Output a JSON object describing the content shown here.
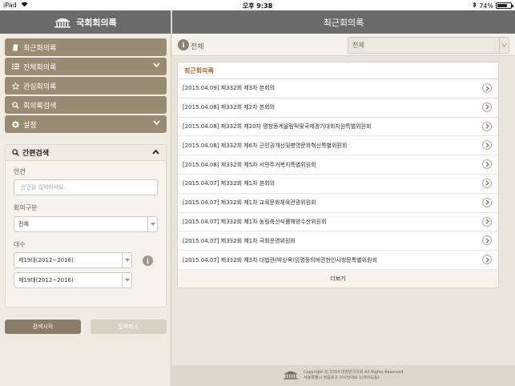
{
  "status_bar": {
    "device": "iPad",
    "time": "오후 9:38",
    "battery": "74%",
    "battery_level": 0.74
  },
  "sidebar": {
    "app_title": "국회회의록",
    "menu": [
      {
        "label": "최근회의록",
        "icon": "document-icon",
        "expand": false
      },
      {
        "label": "전체회의록",
        "icon": "list-icon",
        "expand": true
      },
      {
        "label": "관심회의록",
        "icon": "star-icon",
        "expand": false
      },
      {
        "label": "회의록검색",
        "icon": "search-icon",
        "expand": false
      },
      {
        "label": "설정",
        "icon": "gear-icon",
        "expand": true
      }
    ],
    "quick_search": {
      "title": "간편검색",
      "agenda_label": "안건",
      "agenda_placeholder": "안건을 입력하세요.",
      "meeting_type_label": "회의구분",
      "meeting_type_value": "전체",
      "session_label": "대수",
      "session_from": "제19대(2012~2016)",
      "session_to": "제19대(2012~2016)"
    },
    "search_button": "검색시작",
    "cancel_button": "입력취소"
  },
  "main": {
    "title": "최근회의록",
    "filter_label": "전체",
    "filter_value": "전체",
    "list_title": "최근회의록",
    "rows": [
      "[2015.04.09] 제332회 제3차 본회의",
      "[2015.04.08] 제332회 제2차 본회의",
      "[2015.04.08] 제332회 제20차 평창동계올림픽및국제경기대회지원특별위원회",
      "[2015.04.08] 제332회 제6차 군인권개선및병영문화혁신특별위원회",
      "[2015.04.08] 제332회 제5차 서민주거복지특별위원회",
      "[2015.04.07] 제332회 제1차 본회의",
      "[2015.04.07] 제332회 제1차 교육문화체육관광위원회",
      "[2015.04.07] 제332회 제1차 농림축산식품해양수산위원회",
      "[2015.04.07] 제332회 제1차 국회운영위원회",
      "[2015.04.07] 제332회 제3차 대법관(박상옥)임명동의에관한인사청문특별위원회"
    ],
    "more_label": "더보기",
    "footer_line1": "Copyright © 2014 대한민국국회 All Rights Reserved.",
    "footer_line2": "서울특별시 영등포구 의사당대로 1(여의도동)"
  },
  "colors": {
    "accent_brown": "#9b8a72",
    "header_gray": "#6b6b6b",
    "list_title": "#a0702e"
  }
}
